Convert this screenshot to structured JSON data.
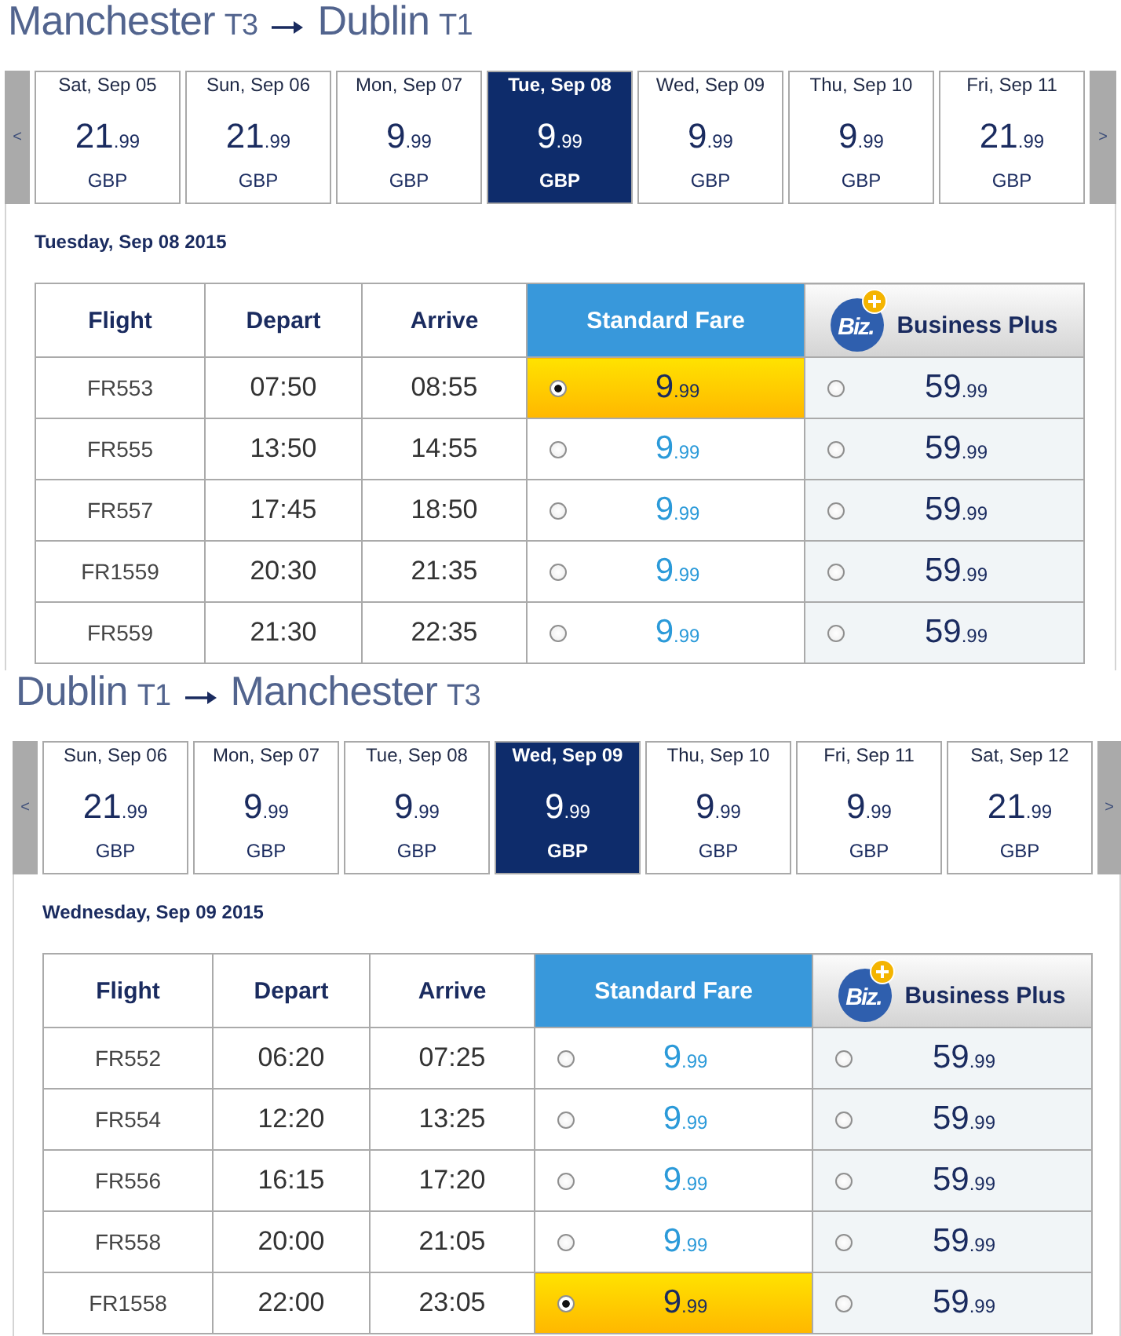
{
  "journeys": [
    {
      "title": {
        "origin": "Manchester",
        "origin_terminal": "T3",
        "destination": "Dublin",
        "destination_terminal": "T1"
      },
      "date_strip": {
        "prev_label": "<",
        "next_label": ">",
        "days": [
          {
            "label": "Sat, Sep 05",
            "price": "21.99",
            "currency": "GBP",
            "selected": false
          },
          {
            "label": "Sun, Sep 06",
            "price": "21.99",
            "currency": "GBP",
            "selected": false
          },
          {
            "label": "Mon, Sep 07",
            "price": "9.99",
            "currency": "GBP",
            "selected": false
          },
          {
            "label": "Tue, Sep 08",
            "price": "9.99",
            "currency": "GBP",
            "selected": true
          },
          {
            "label": "Wed, Sep 09",
            "price": "9.99",
            "currency": "GBP",
            "selected": false
          },
          {
            "label": "Thu, Sep 10",
            "price": "9.99",
            "currency": "GBP",
            "selected": false
          },
          {
            "label": "Fri, Sep 11",
            "price": "21.99",
            "currency": "GBP",
            "selected": false
          }
        ]
      },
      "selected_date": "Tuesday, Sep 08 2015",
      "table": {
        "columns": [
          "Flight",
          "Depart",
          "Arrive"
        ],
        "fare_columns": [
          {
            "kind": "standard",
            "label": "Standard Fare"
          },
          {
            "kind": "business",
            "label": "Business Plus",
            "logo_text": "Biz."
          }
        ],
        "rows": [
          {
            "flight": "FR553",
            "depart": "07:50",
            "arrive": "08:55",
            "fares": [
              {
                "price": "9.99",
                "selected": true
              },
              {
                "price": "59.99",
                "selected": false
              }
            ]
          },
          {
            "flight": "FR555",
            "depart": "13:50",
            "arrive": "14:55",
            "fares": [
              {
                "price": "9.99",
                "selected": false
              },
              {
                "price": "59.99",
                "selected": false
              }
            ]
          },
          {
            "flight": "FR557",
            "depart": "17:45",
            "arrive": "18:50",
            "fares": [
              {
                "price": "9.99",
                "selected": false
              },
              {
                "price": "59.99",
                "selected": false
              }
            ]
          },
          {
            "flight": "FR1559",
            "depart": "20:30",
            "arrive": "21:35",
            "fares": [
              {
                "price": "9.99",
                "selected": false
              },
              {
                "price": "59.99",
                "selected": false
              }
            ]
          },
          {
            "flight": "FR559",
            "depart": "21:30",
            "arrive": "22:35",
            "fares": [
              {
                "price": "9.99",
                "selected": false
              },
              {
                "price": "59.99",
                "selected": false
              }
            ]
          }
        ]
      }
    },
    {
      "title": {
        "origin": "Dublin",
        "origin_terminal": "T1",
        "destination": "Manchester",
        "destination_terminal": "T3"
      },
      "date_strip": {
        "prev_label": "<",
        "next_label": ">",
        "days": [
          {
            "label": "Sun, Sep 06",
            "price": "21.99",
            "currency": "GBP",
            "selected": false
          },
          {
            "label": "Mon, Sep 07",
            "price": "9.99",
            "currency": "GBP",
            "selected": false
          },
          {
            "label": "Tue, Sep 08",
            "price": "9.99",
            "currency": "GBP",
            "selected": false
          },
          {
            "label": "Wed, Sep 09",
            "price": "9.99",
            "currency": "GBP",
            "selected": true
          },
          {
            "label": "Thu, Sep 10",
            "price": "9.99",
            "currency": "GBP",
            "selected": false
          },
          {
            "label": "Fri, Sep 11",
            "price": "9.99",
            "currency": "GBP",
            "selected": false
          },
          {
            "label": "Sat, Sep 12",
            "price": "21.99",
            "currency": "GBP",
            "selected": false
          }
        ]
      },
      "selected_date": "Wednesday, Sep 09 2015",
      "table": {
        "columns": [
          "Flight",
          "Depart",
          "Arrive"
        ],
        "fare_columns": [
          {
            "kind": "standard",
            "label": "Standard Fare"
          },
          {
            "kind": "business",
            "label": "Business Plus",
            "logo_text": "Biz."
          }
        ],
        "rows": [
          {
            "flight": "FR552",
            "depart": "06:20",
            "arrive": "07:25",
            "fares": [
              {
                "price": "9.99",
                "selected": false
              },
              {
                "price": "59.99",
                "selected": false
              }
            ]
          },
          {
            "flight": "FR554",
            "depart": "12:20",
            "arrive": "13:25",
            "fares": [
              {
                "price": "9.99",
                "selected": false
              },
              {
                "price": "59.99",
                "selected": false
              }
            ]
          },
          {
            "flight": "FR556",
            "depart": "16:15",
            "arrive": "17:20",
            "fares": [
              {
                "price": "9.99",
                "selected": false
              },
              {
                "price": "59.99",
                "selected": false
              }
            ]
          },
          {
            "flight": "FR558",
            "depart": "20:00",
            "arrive": "21:05",
            "fares": [
              {
                "price": "9.99",
                "selected": false
              },
              {
                "price": "59.99",
                "selected": false
              }
            ]
          },
          {
            "flight": "FR1558",
            "depart": "22:00",
            "arrive": "23:05",
            "fares": [
              {
                "price": "9.99",
                "selected": true
              },
              {
                "price": "59.99",
                "selected": false
              }
            ]
          }
        ]
      }
    }
  ]
}
